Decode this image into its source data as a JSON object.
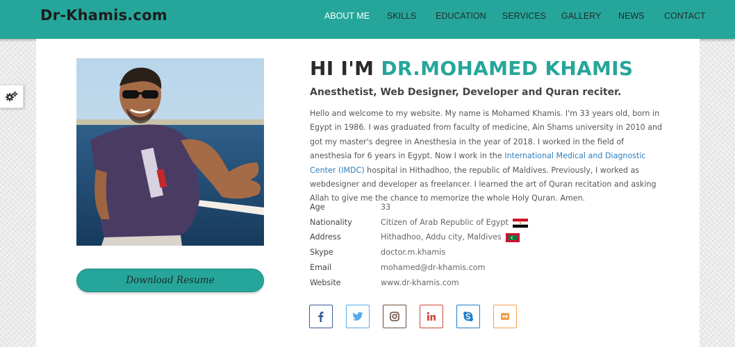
{
  "brand": "Dr-Khamis.com",
  "nav": [
    {
      "label": "ABOUT ME",
      "active": true
    },
    {
      "label": "SKILLS",
      "active": false
    },
    {
      "label": "EDUCATION",
      "active": false
    },
    {
      "label": "SERVICES",
      "active": false
    },
    {
      "label": "GALLERY",
      "active": false
    },
    {
      "label": "NEWS",
      "active": false
    },
    {
      "label": "CONTACT",
      "active": false
    }
  ],
  "settings_icon": "gears-icon",
  "download_label": "Download Resume",
  "heading": {
    "prefix": "HI I'M ",
    "name": "DR.MOHAMED KHAMIS"
  },
  "subtitle": "Anesthetist, Web Designer, Developer and Quran reciter.",
  "bio": {
    "before": "Hello and welcome to my website. My name is Mohamed Khamis. I'm 33 years old, born in Egypt in 1986. I was graduated from faculty of medicine, Ain Shams university in 2010 and got my master's degree in Anesthesia in the year of 2018. I worked in the field of anesthesia for 6 years in Egypt. Now I work in the ",
    "link": "International Medical and Diagnostic Center (IMDC)",
    "after": " hospital in Hithadhoo, the republic of Maldives. Previously, I worked as webdesigner and developer as freelancer. I learned the art of Quran recitation and asking Allah to give me the chance to memorize the whole Holy Quran. Amen."
  },
  "info": {
    "age": {
      "label": "Age",
      "value": "33"
    },
    "nationality": {
      "label": "Nationality",
      "value": "Citizen of Arab Republic of Egypt"
    },
    "address": {
      "label": "Address",
      "value": "Hithadhoo, Addu city, Maldives"
    },
    "skype": {
      "label": "Skype",
      "value": "doctor.m.khamis"
    },
    "email": {
      "label": "Email",
      "value": "mohamed@dr-khamis.com"
    },
    "website": {
      "label": "Website",
      "value": "www.dr-khamis.com"
    }
  },
  "socials": [
    {
      "name": "facebook-icon",
      "color": "#3b5998"
    },
    {
      "name": "twitter-icon",
      "color": "#55acee"
    },
    {
      "name": "instagram-icon",
      "color": "#6b4a3e"
    },
    {
      "name": "linkedin-icon",
      "color": "#d0453a"
    },
    {
      "name": "skype-icon",
      "color": "#1f7ec8"
    },
    {
      "name": "flickr-icon",
      "color": "#f39c4a"
    }
  ],
  "colors": {
    "accent": "#26a69a",
    "link": "#2c7ec0",
    "heading": "#2a2a2a"
  }
}
